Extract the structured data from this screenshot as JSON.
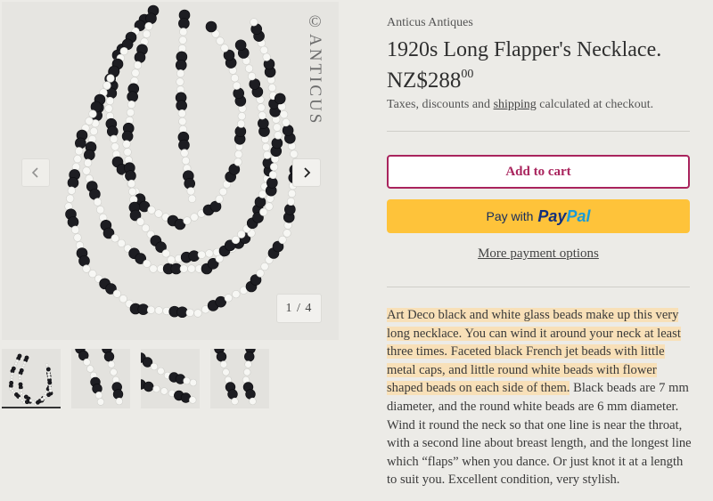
{
  "gallery": {
    "watermark": "©ANTICUS",
    "counter": "1 / 4",
    "prev_icon": "chevron-left-icon",
    "next_icon": "chevron-right-icon",
    "thumbnails": [
      "thumbnail-1",
      "thumbnail-2",
      "thumbnail-3",
      "thumbnail-4"
    ]
  },
  "product": {
    "vendor": "Anticus Antiques",
    "title": "1920s Long Flapper's Necklace.",
    "price_main": "NZ$288",
    "price_cents": "00",
    "tax_before": "Taxes, discounts and ",
    "tax_link": "shipping",
    "tax_after": " calculated at checkout."
  },
  "buttons": {
    "add_to_cart": "Add to cart",
    "pay_with": "Pay with",
    "paypal_part1": "Pay",
    "paypal_part2": "Pal",
    "more_options": "More payment options"
  },
  "description": {
    "highlighted": "Art Deco black and white glass beads make up this very long necklace. You can wind it around your neck at least three times. Faceted black French jet beads with little metal caps, and little round white beads with flower shaped beads on each side of them.",
    "rest": " Black beads are 7 mm diameter, and the round white beads are 6 mm diameter. Wind it round the neck so that one line is near the throat, with a second line about breast length, and the longest line which “flaps” when you dance. Or just knot it at a length to suit you. Excellent condition, very stylish."
  },
  "colors": {
    "background": "#ecebe7",
    "accent": "#a9245d",
    "paypal_yellow": "#fec33a",
    "highlight": "#f8e0b8"
  }
}
